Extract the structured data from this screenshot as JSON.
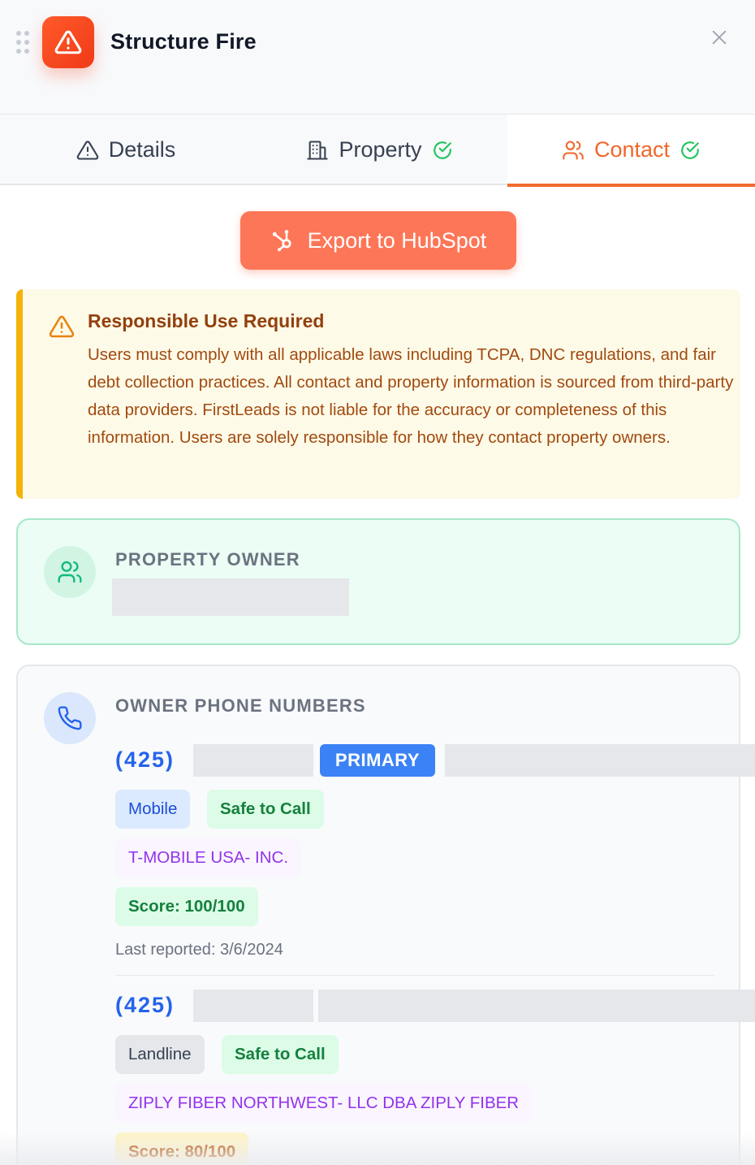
{
  "header": {
    "title": "Structure Fire",
    "icon": "warning-triangle-icon",
    "accent_color": "#f24d1f"
  },
  "tabs": [
    {
      "label": "Details",
      "icon": "alert-triangle-icon",
      "completed": false,
      "active": false
    },
    {
      "label": "Property",
      "icon": "building-icon",
      "completed": true,
      "active": false
    },
    {
      "label": "Contact",
      "icon": "users-icon",
      "completed": true,
      "active": true
    }
  ],
  "export": {
    "label": "Export to HubSpot",
    "icon": "hubspot-icon"
  },
  "notice": {
    "title": "Responsible Use Required",
    "text": "Users must comply with all applicable laws including TCPA, DNC regulations, and fair debt collection practices. All contact and property information is sourced from third-party data providers. FirstLeads is not liable for the accuracy or completeness of this information. Users are solely responsible for how they contact property owners."
  },
  "owner": {
    "label": "PROPERTY OWNER",
    "icon": "users-icon"
  },
  "phones": {
    "label": "OWNER PHONE NUMBERS",
    "icon": "phone-icon",
    "items": [
      {
        "area_code": "(425)",
        "primary_label": "PRIMARY",
        "type": "Mobile",
        "status": "Safe to Call",
        "carrier": "T-MOBILE USA- INC.",
        "score": "Score: 100/100",
        "last_reported": "Last reported: 3/6/2024"
      },
      {
        "area_code": "(425)",
        "type": "Landline",
        "status": "Safe to Call",
        "carrier": "ZIPLY FIBER NORTHWEST- LLC DBA ZIPLY FIBER",
        "score": "Score: 80/100"
      }
    ]
  }
}
